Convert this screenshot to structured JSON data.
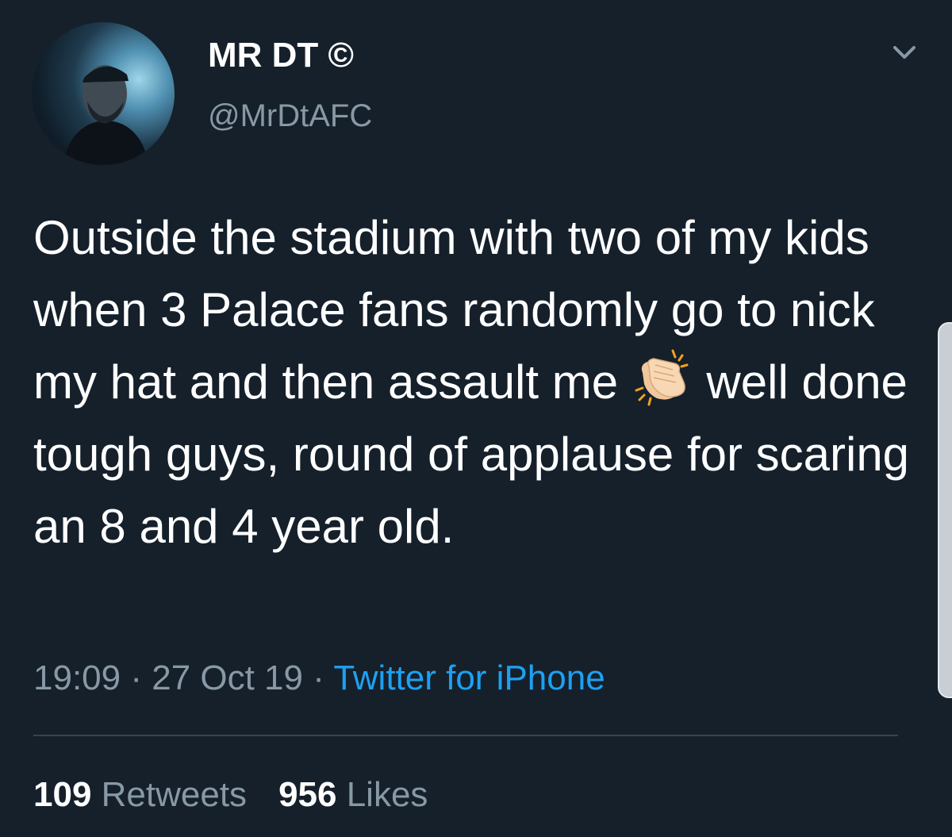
{
  "author": {
    "display_name": "MR DT ©",
    "handle": "@MrDtAFC"
  },
  "tweet": {
    "text_before_emoji": "Outside the stadium with two of my kids when 3 Palace fans randomly go to nick my hat and then assault me ",
    "emoji": "clapping-hands",
    "text_after_emoji": " well done tough guys, round of applause for scaring an 8 and 4 year old."
  },
  "meta": {
    "time": "19:09",
    "separator": " · ",
    "date": "27 Oct 19",
    "source": "Twitter for iPhone"
  },
  "stats": {
    "retweets_count": "109",
    "retweets_label": " Retweets",
    "likes_count": "956",
    "likes_label": " Likes"
  },
  "colors": {
    "background": "#15202b",
    "primary_text": "#ffffff",
    "secondary_text": "#8899a6",
    "link": "#1da1f2",
    "divider": "#38444d"
  }
}
